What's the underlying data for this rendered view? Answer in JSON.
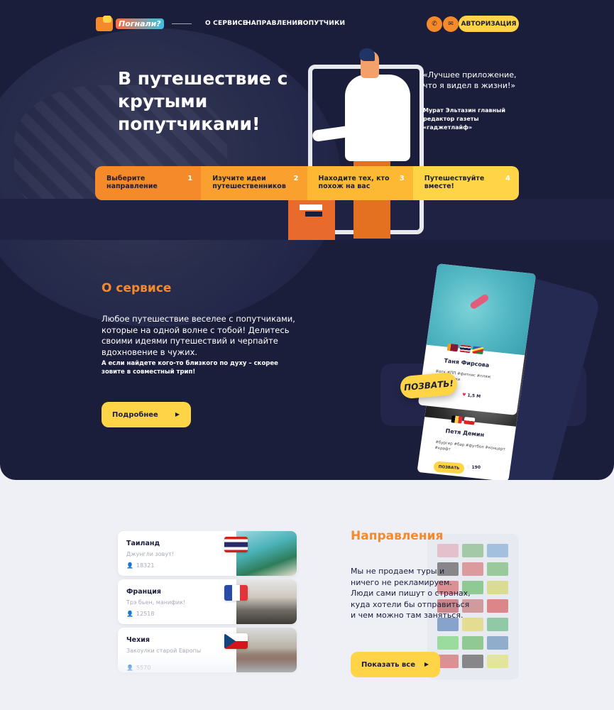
{
  "header": {
    "logo_text": "Погнали?",
    "nav": [
      "О СЕРВИСЕ",
      "НАПРАВЛЕНИЯ",
      "ПОПУТЧИКИ"
    ],
    "phone_icon": "phone-icon",
    "mail_icon": "mail-icon",
    "auth_label": "АВТОРИЗАЦИЯ"
  },
  "hero": {
    "title": "В путешествие с крутыми попутчиками!",
    "quote": "«Лучшее приложение, что я видел в жизни!»",
    "quote_author": "Мурат Эльтазин главный редактор газеты «гаджетлайф»",
    "steps": [
      {
        "label": "Выберите направление",
        "number": "1"
      },
      {
        "label": "Изучите идеи путешественников",
        "number": "2"
      },
      {
        "label": "Находите тех, кто похож на вас",
        "number": "3"
      },
      {
        "label": "Путешествуйте вместе!",
        "number": "4"
      }
    ]
  },
  "about": {
    "title": "О сервисе",
    "text": "Любое путешествие веселее с попутчиками, которые на одной волне с тобой! Делитесь своими идеями путешествий и черпайте вдохновение в чужих.",
    "bold_text": "А если найдете кого-то близкого по духу – скорее зовите в совместный трип!",
    "button": "Подробнее",
    "go_button": "ПОЗВАТЬ!",
    "profile1": {
      "name": "Таня Фирсова",
      "tags": "#отк #ПП #фитнес #пляж #вкусняшки",
      "likes": "1,5 M"
    },
    "profile2": {
      "name": "Петя Демин",
      "tags": "#бургер #бар #футбол #концерт #крафт",
      "button": "ПОЗВАТЬ",
      "likes": "190"
    }
  },
  "directions": {
    "title": "Направления",
    "text": "Мы не продаем туры и ничего не рекламируем. Люди сами пишут о странах, куда хотели бы отправиться и чем можно там заняться.",
    "button": "Показать все",
    "items": [
      {
        "name": "Таиланд",
        "subtitle": "Джунгли зовут!",
        "count": "18321"
      },
      {
        "name": "Франция",
        "subtitle": "Трэ бьен, манифик!",
        "count": "12518"
      },
      {
        "name": "Чехия",
        "subtitle": "Закоулки старой Европы",
        "count": "5570"
      }
    ]
  },
  "colors": {
    "dark": "#1b1e3b",
    "orange": "#f58a2b",
    "yellow": "#ffd447",
    "light_bg": "#eef0f6"
  }
}
